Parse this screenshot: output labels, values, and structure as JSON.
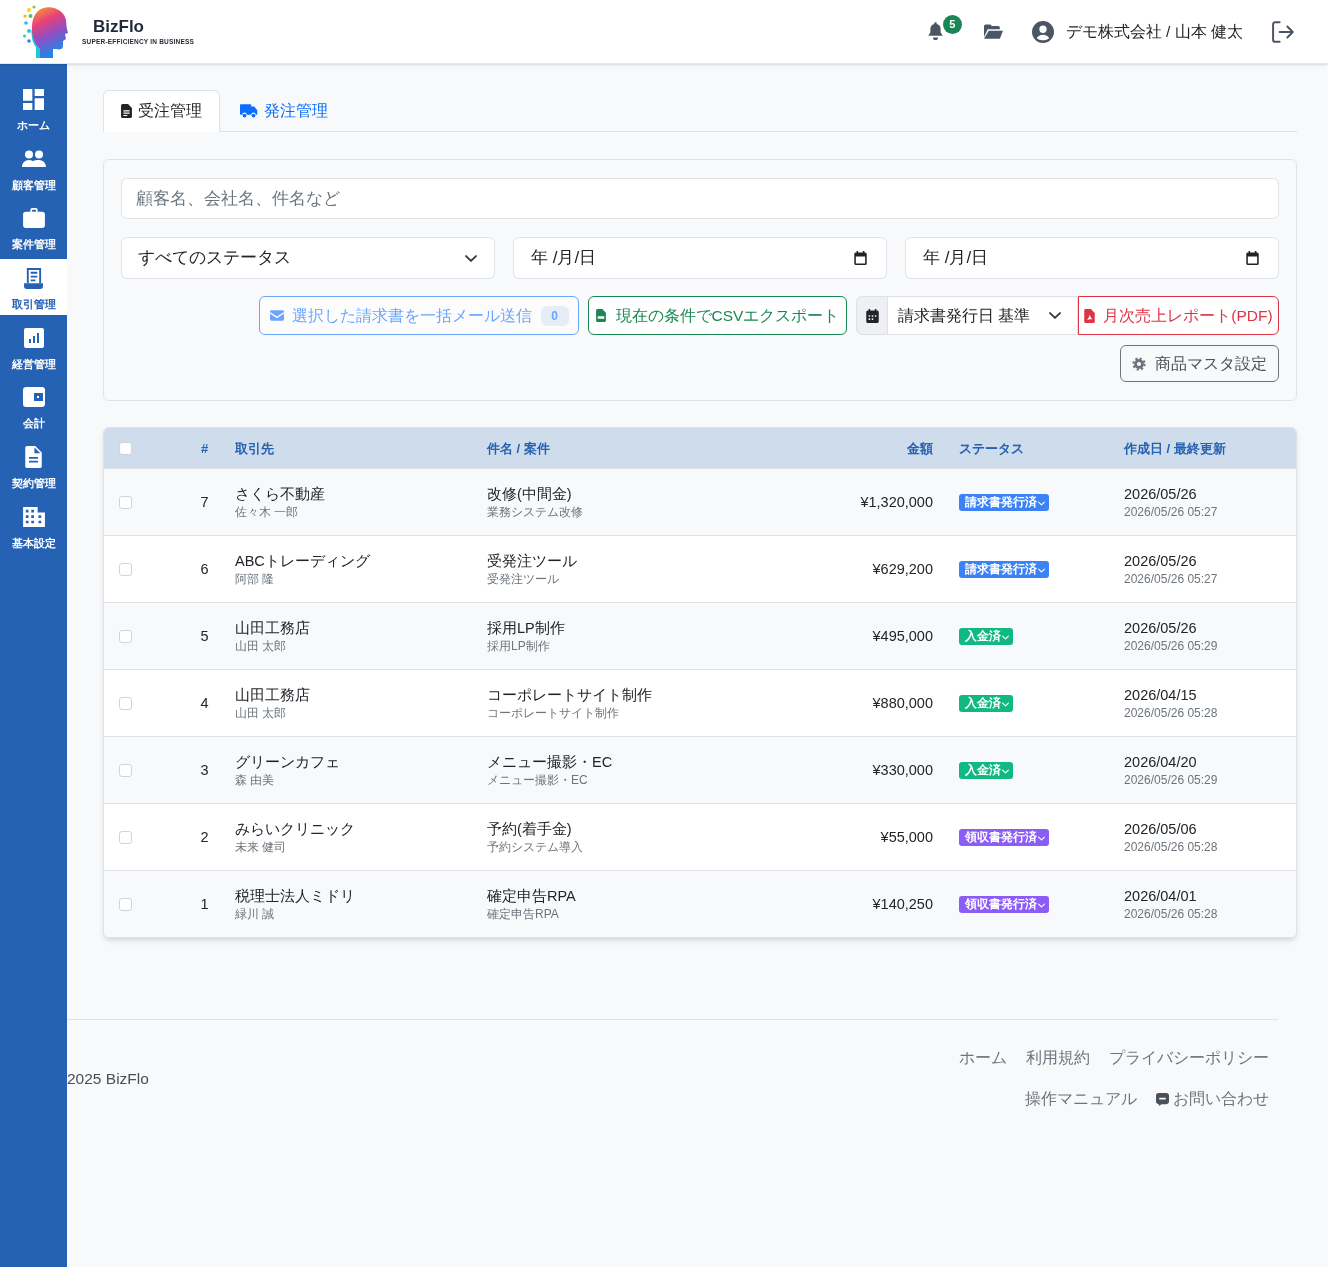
{
  "header": {
    "brand": "BizFlo",
    "tagline": "SUPER-EFFICIENCY IN BUSINESS",
    "notification_count": "5",
    "user": "デモ株式会社 / 山本 健太"
  },
  "sidebar": {
    "items": [
      {
        "label": "ホーム",
        "selected": false
      },
      {
        "label": "顧客管理",
        "selected": false
      },
      {
        "label": "案件管理",
        "selected": false
      },
      {
        "label": "取引管理",
        "selected": true
      },
      {
        "label": "経営管理",
        "selected": false
      },
      {
        "label": "会計",
        "selected": false
      },
      {
        "label": "契約管理",
        "selected": false
      },
      {
        "label": "基本設定",
        "selected": false
      }
    ]
  },
  "tabs": [
    {
      "label": "受注管理",
      "selected": true
    },
    {
      "label": "発注管理",
      "selected": false
    }
  ],
  "filters": {
    "search": {
      "placeholder": "顧客名、会社名、件名など"
    },
    "status": {
      "value": "すべてのステータス"
    },
    "date_from": {
      "placeholder": "年 /月/日"
    },
    "date_to": {
      "placeholder": "年 /月/日"
    }
  },
  "actions": {
    "bulk_email": {
      "label": "選択した請求書を一括メール送信",
      "count": "0",
      "disabled": true
    },
    "csv_export": {
      "label": "現在の条件でCSVエクスポート"
    },
    "date_basis": {
      "value": "請求書発行日 基準"
    },
    "monthly_report": {
      "label": "月次売上レポート(PDF)"
    },
    "product_master": {
      "label": "商品マスタ設定"
    }
  },
  "table": {
    "select_all_checked": false,
    "columns": [
      "#",
      "取引先",
      "件名 / 案件",
      "金額",
      "ステータス",
      "作成日 / 最終更新"
    ],
    "rows": [
      {
        "checked": false,
        "no": "7",
        "client": "さくら不動産",
        "contact": "佐々木 一郎",
        "title": "改修(中間金)",
        "project": "業務システム改修",
        "amount": "¥1,320,000",
        "status": {
          "label": "請求書発行済",
          "color": "#3b82f6"
        },
        "date": "2026/05/26",
        "updated": "2026/05/26 05:27"
      },
      {
        "checked": false,
        "no": "6",
        "client": "ABCトレーディング",
        "contact": "阿部 隆",
        "title": "受発注ツール",
        "project": "受発注ツール",
        "amount": "¥629,200",
        "status": {
          "label": "請求書発行済",
          "color": "#3b82f6"
        },
        "date": "2026/05/26",
        "updated": "2026/05/26 05:27"
      },
      {
        "checked": false,
        "no": "5",
        "client": "山田工務店",
        "contact": "山田 太郎",
        "title": "採用LP制作",
        "project": "採用LP制作",
        "amount": "¥495,000",
        "status": {
          "label": "入金済",
          "color": "#10b981"
        },
        "date": "2026/05/26",
        "updated": "2026/05/26 05:29"
      },
      {
        "checked": false,
        "no": "4",
        "client": "山田工務店",
        "contact": "山田 太郎",
        "title": "コーポレートサイト制作",
        "project": "コーポレートサイト制作",
        "amount": "¥880,000",
        "status": {
          "label": "入金済",
          "color": "#10b981"
        },
        "date": "2026/04/15",
        "updated": "2026/05/26 05:28"
      },
      {
        "checked": false,
        "no": "3",
        "client": "グリーンカフェ",
        "contact": "森 由美",
        "title": "メニュー撮影・EC",
        "project": "メニュー撮影・EC",
        "amount": "¥330,000",
        "status": {
          "label": "入金済",
          "color": "#10b981"
        },
        "date": "2026/04/20",
        "updated": "2026/05/26 05:29"
      },
      {
        "checked": false,
        "no": "2",
        "client": "みらいクリニック",
        "contact": "未来 健司",
        "title": "予約(着手金)",
        "project": "予約システム導入",
        "amount": "¥55,000",
        "status": {
          "label": "領収書発行済",
          "color": "#8b5cf6"
        },
        "date": "2026/05/06",
        "updated": "2026/05/26 05:28"
      },
      {
        "checked": false,
        "no": "1",
        "client": "税理士法人ミドリ",
        "contact": "緑川 誠",
        "title": "確定申告RPA",
        "project": "確定申告RPA",
        "amount": "¥140,250",
        "status": {
          "label": "領収書発行済",
          "color": "#8b5cf6"
        },
        "date": "2026/04/01",
        "updated": "2026/05/26 05:28"
      }
    ]
  },
  "footer": {
    "copyright": "2025 BizFlo",
    "link_rows": [
      [
        {
          "label": "ホーム",
          "kind": "text"
        },
        {
          "label": "利用規約",
          "kind": "text"
        },
        {
          "label": "プライバシーポリシー",
          "kind": "text"
        }
      ],
      [
        {
          "label": "操作マニュアル",
          "kind": "text"
        },
        {
          "label": "お問い合わせ",
          "kind": "chat"
        }
      ]
    ]
  }
}
